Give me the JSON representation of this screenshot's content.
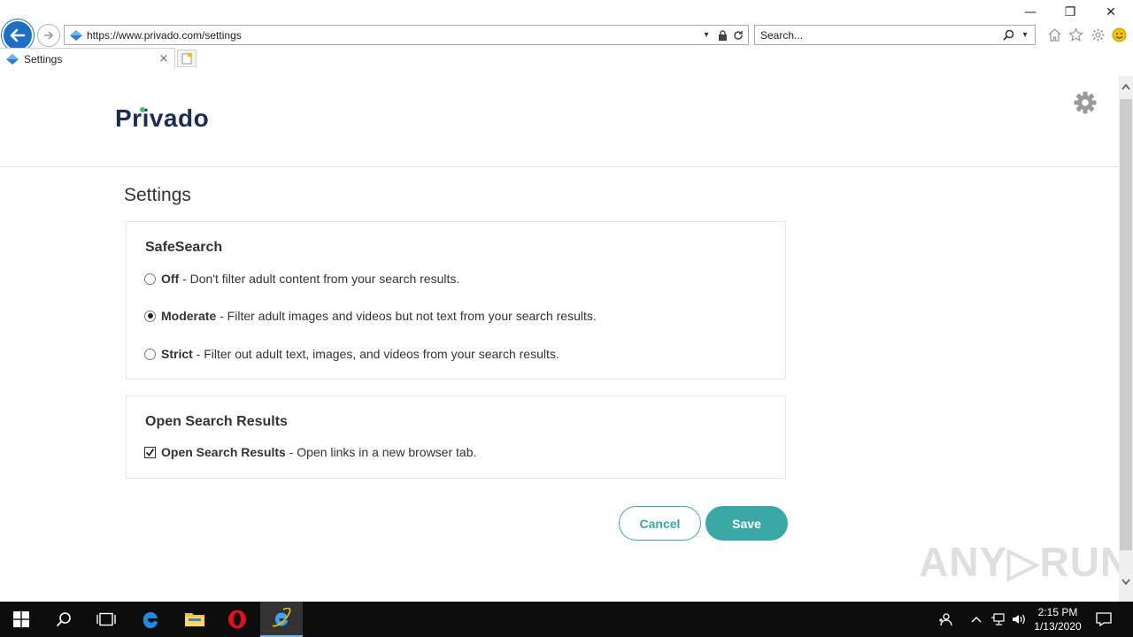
{
  "browser": {
    "address": "https://www.privado.com/settings",
    "search_placeholder": "Search...",
    "tab_label": "Settings",
    "tab_close": "×",
    "win_minimize": "—",
    "win_restore": "❐",
    "win_close": "✕"
  },
  "site": {
    "logo_text": "Privado",
    "page_title": "Settings"
  },
  "safesearch": {
    "title": "SafeSearch",
    "selected": "moderate",
    "options": [
      {
        "id": "off",
        "label": "Off",
        "description": " - Don't filter adult content from your search results."
      },
      {
        "id": "moderate",
        "label": "Moderate",
        "description": " - Filter adult images and videos but not text from your search results."
      },
      {
        "id": "strict",
        "label": "Strict",
        "description": " - Filter out adult text, images, and videos from your search results."
      }
    ]
  },
  "open_results": {
    "title": "Open Search Results",
    "checked": true,
    "label": "Open Search Results",
    "description": " - Open links in a new browser tab."
  },
  "actions": {
    "cancel_label": "Cancel",
    "save_label": "Save"
  },
  "watermark": "ANY▷RUN",
  "taskbar": {
    "time": "2:15 PM",
    "date": "1/13/2020"
  },
  "colors": {
    "accent": "#3aa9a6",
    "logo": "#1d2d50",
    "logo_dot": "#3ec46d",
    "ie_blue": "#1c6fc4"
  }
}
